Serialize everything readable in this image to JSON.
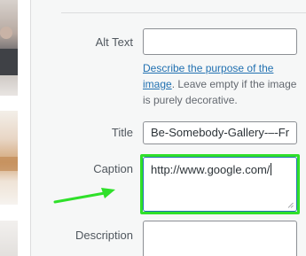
{
  "fields": {
    "alt_text": {
      "label": "Alt Text",
      "value": ""
    },
    "alt_help": {
      "link_text": "Describe the purpose of the image",
      "text": ". Leave empty if the image is purely decorative."
    },
    "title": {
      "label": "Title",
      "value": "Be-Somebody-Gallery-–-Fr"
    },
    "caption": {
      "label": "Caption",
      "value": "http://www.google.com/"
    },
    "description": {
      "label": "Description",
      "value": ""
    }
  },
  "colors": {
    "highlight": "#2fe02a",
    "link": "#2271b1",
    "arrow": "#2fe02a"
  },
  "icons": [
    "resize-handle-icon",
    "annotation-arrow-icon"
  ]
}
